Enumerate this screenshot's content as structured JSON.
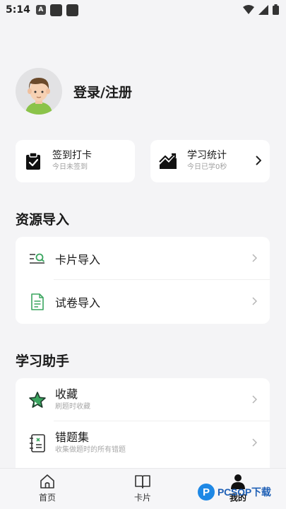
{
  "status": {
    "time": "5:14",
    "notif_a": "A"
  },
  "profile": {
    "login_label": "登录/注册"
  },
  "checkin": {
    "title": "签到打卡",
    "subtitle": "今日未签到"
  },
  "stats": {
    "title": "学习统计",
    "subtitle": "今日已学0秒"
  },
  "resource_import": {
    "title": "资源导入",
    "items": [
      {
        "label": "卡片导入",
        "icon": "card-search-icon"
      },
      {
        "label": "试卷导入",
        "icon": "document-icon"
      }
    ]
  },
  "study_helper": {
    "title": "学习助手",
    "items": [
      {
        "title": "收藏",
        "subtitle": "刷题时收藏",
        "icon": "star-icon"
      },
      {
        "title": "错题集",
        "subtitle": "收集做题时的所有错题",
        "icon": "wrong-book-icon"
      }
    ]
  },
  "nav": {
    "items": [
      {
        "label": "首页",
        "icon": "home-icon"
      },
      {
        "label": "卡片",
        "icon": "book-icon"
      },
      {
        "label": "我的",
        "icon": "person-icon"
      }
    ],
    "active": "我的"
  },
  "watermark": {
    "badge": "P",
    "text": "PCSOP下载"
  },
  "colors": {
    "accent_green": "#3aa55f",
    "background": "#f4f4f6",
    "card": "#ffffff"
  }
}
